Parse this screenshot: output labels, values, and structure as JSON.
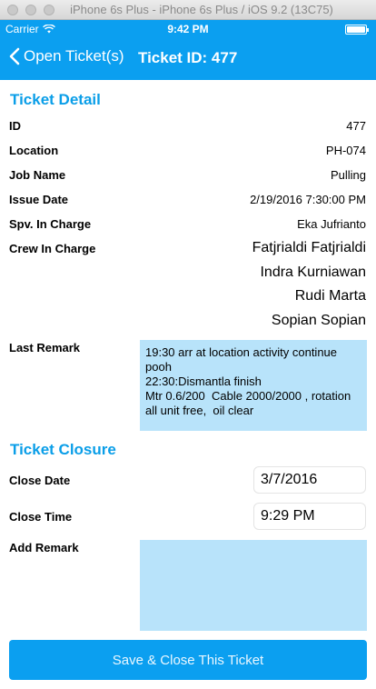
{
  "simulator": {
    "title": "iPhone 6s Plus - iPhone 6s Plus / iOS 9.2 (13C75)"
  },
  "status_bar": {
    "carrier": "Carrier",
    "time": "9:42 PM"
  },
  "nav": {
    "back_label": "Open Ticket(s)",
    "title": "Ticket ID: 477",
    "accent_color": "#0b9ff0"
  },
  "ticket_detail": {
    "section_title": "Ticket Detail",
    "rows": [
      {
        "label": "ID",
        "value": "477"
      },
      {
        "label": "Location",
        "value": "PH-074"
      },
      {
        "label": "Job Name",
        "value": "Pulling"
      },
      {
        "label": "Issue Date",
        "value": "2/19/2016 7:30:00 PM"
      },
      {
        "label": "Spv. In Charge",
        "value": "Eka Jufrianto"
      }
    ],
    "crew_label": "Crew In Charge",
    "crew": [
      "Fatjrialdi Fatjrialdi",
      "Indra Kurniawan",
      "Rudi Marta",
      "Sopian Sopian"
    ],
    "last_remark_label": "Last Remark",
    "last_remark": "19:30 arr at location activity continue pooh\n22:30:Dismantla finish\nMtr 0.6/200  Cable 2000/2000 , rotation all unit free,  oil clear"
  },
  "ticket_closure": {
    "section_title": "Ticket Closure",
    "close_date_label": "Close Date",
    "close_date": "3/7/2016",
    "close_time_label": "Close Time",
    "close_time": "9:29 PM",
    "add_remark_label": "Add Remark",
    "add_remark_value": ""
  },
  "actions": {
    "save_label": "Save & Close This Ticket"
  }
}
